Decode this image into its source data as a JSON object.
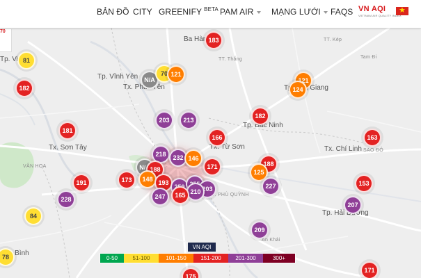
{
  "nav": {
    "items": [
      {
        "label": "BẢN ĐỒ",
        "has_dropdown": false
      },
      {
        "label": "CITY",
        "has_dropdown": false
      },
      {
        "label": "GREENIFY",
        "badge": "BETA",
        "has_dropdown": false
      },
      {
        "label": "PAM AIR",
        "has_dropdown": true
      },
      {
        "label": "MẠNG LƯỚI",
        "has_dropdown": true
      },
      {
        "label": "FAQS",
        "has_dropdown": false
      }
    ],
    "brand": {
      "name": "VN AQI",
      "tagline": "VIETNAM AIR QUALITY INDEX"
    },
    "flag_icon": "vietnam-flag-icon"
  },
  "map": {
    "places": [
      "Ba Hàng",
      "TT. Kép",
      "Tp. Việt",
      "Tp. Vĩnh Yên",
      "TT. Thắng",
      "Tam Đi",
      "Tx. Phúc Yên",
      "Tp. Bắc Giang",
      "Tp. Bắc Ninh",
      "Tx. Sơn Tây",
      "Tx. Từ Sơn",
      "Tx. Chí Linh",
      "VÂN HOA",
      "SAO ĐỎ",
      "TT. PHÙ QUỲNH",
      "Tp. Hải Dương",
      "An Khải",
      "Hòa Bình"
    ],
    "partial_marker_top_left": "70",
    "markers": [
      {
        "value": "183",
        "level": "151-200"
      },
      {
        "value": "81",
        "level": "51-100"
      },
      {
        "value": "182",
        "level": "151-200"
      },
      {
        "value": "N/A",
        "level": "na"
      },
      {
        "value": "70",
        "level": "51-100"
      },
      {
        "value": "121",
        "level": "101-150"
      },
      {
        "value": "121",
        "level": "101-150"
      },
      {
        "value": "124",
        "level": "101-150"
      },
      {
        "value": "182",
        "level": "151-200"
      },
      {
        "value": "203",
        "level": "201-300"
      },
      {
        "value": "213",
        "level": "201-300"
      },
      {
        "value": "181",
        "level": "151-200"
      },
      {
        "value": "166",
        "level": "151-200"
      },
      {
        "value": "163",
        "level": "151-200"
      },
      {
        "value": "218",
        "level": "201-300"
      },
      {
        "value": "232",
        "level": "201-300"
      },
      {
        "value": "146",
        "level": "101-150"
      },
      {
        "value": "171",
        "level": "151-200"
      },
      {
        "value": "188",
        "level": "151-200"
      },
      {
        "value": "N/A",
        "level": "na"
      },
      {
        "value": "188",
        "level": "151-200"
      },
      {
        "value": "125",
        "level": "101-150"
      },
      {
        "value": "191",
        "level": "151-200"
      },
      {
        "value": "173",
        "level": "151-200"
      },
      {
        "value": "148",
        "level": "101-150"
      },
      {
        "value": "193",
        "level": "151-200"
      },
      {
        "value": "259",
        "level": "201-300"
      },
      {
        "value": "255",
        "level": "201-300"
      },
      {
        "value": "203",
        "level": "201-300"
      },
      {
        "value": "210",
        "level": "201-300"
      },
      {
        "value": "227",
        "level": "201-300"
      },
      {
        "value": "153",
        "level": "151-200"
      },
      {
        "value": "228",
        "level": "201-300"
      },
      {
        "value": "247",
        "level": "201-300"
      },
      {
        "value": "165",
        "level": "151-200"
      },
      {
        "value": "207",
        "level": "201-300"
      },
      {
        "value": "84",
        "level": "51-100"
      },
      {
        "value": "209",
        "level": "201-300"
      },
      {
        "value": "78",
        "level": "51-100"
      },
      {
        "value": "171",
        "level": "151-200"
      },
      {
        "value": "175",
        "level": "151-200"
      }
    ]
  },
  "legend": {
    "title": "VN AQI",
    "levels": [
      {
        "label": "0-50",
        "color": "#00a64f"
      },
      {
        "label": "51-100",
        "color": "#ffde32"
      },
      {
        "label": "101-150",
        "color": "#ff7e00"
      },
      {
        "label": "151-200",
        "color": "#e32222"
      },
      {
        "label": "201-300",
        "color": "#8f3f97"
      },
      {
        "label": "300+",
        "color": "#7e0023"
      }
    ]
  }
}
